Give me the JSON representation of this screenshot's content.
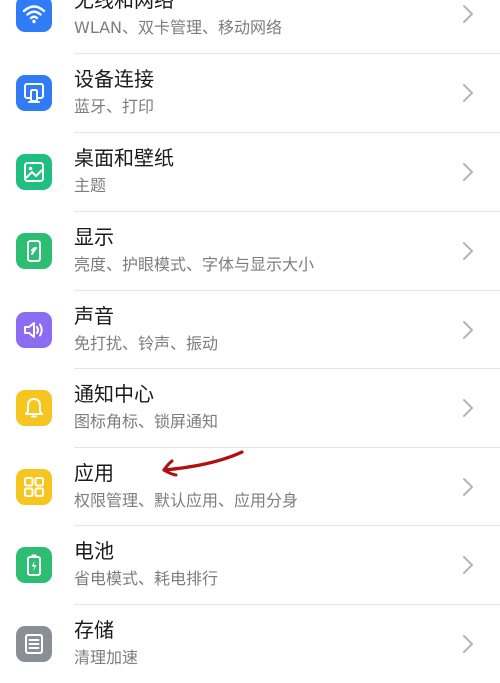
{
  "settings": {
    "items": [
      {
        "title": "无线和网络",
        "subtitle": "WLAN、双卡管理、移动网络",
        "icon": "wifi-icon",
        "color": "#2f7cf6"
      },
      {
        "title": "设备连接",
        "subtitle": "蓝牙、打印",
        "icon": "device-connection-icon",
        "color": "#2f7cf6"
      },
      {
        "title": "桌面和壁纸",
        "subtitle": "主题",
        "icon": "wallpaper-icon",
        "color": "#1fbf82"
      },
      {
        "title": "显示",
        "subtitle": "亮度、护眼模式、字体与显示大小",
        "icon": "display-icon",
        "color": "#2dbd73"
      },
      {
        "title": "声音",
        "subtitle": "免打扰、铃声、振动",
        "icon": "sound-icon",
        "color": "#8c6cf0"
      },
      {
        "title": "通知中心",
        "subtitle": "图标角标、锁屏通知",
        "icon": "bell-icon",
        "color": "#f7c51f"
      },
      {
        "title": "应用",
        "subtitle": "权限管理、默认应用、应用分身",
        "icon": "apps-grid-icon",
        "color": "#f7c51f"
      },
      {
        "title": "电池",
        "subtitle": "省电模式、耗电排行",
        "icon": "battery-icon",
        "color": "#2dbd73"
      },
      {
        "title": "存储",
        "subtitle": "清理加速",
        "icon": "storage-icon",
        "color": "#8a8f96"
      }
    ]
  },
  "annotation": {
    "icon": "red-arrow-annotation",
    "color": "#b01010"
  }
}
